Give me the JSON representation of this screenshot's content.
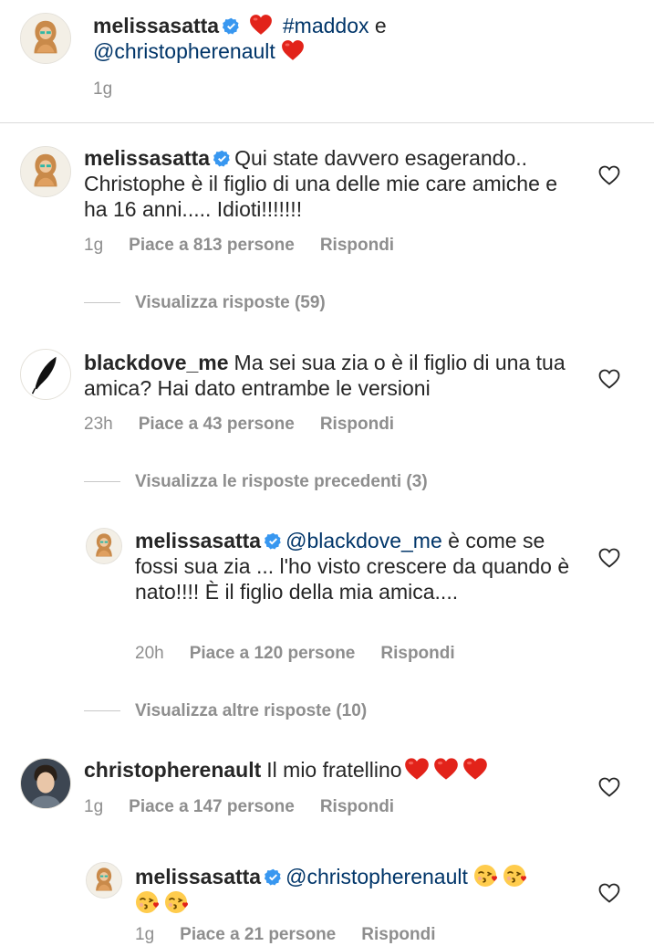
{
  "caption": {
    "username": "melissasatta",
    "hashtag": "#maddox",
    "conj": "e",
    "mention": "@christopherenault",
    "time": "1g"
  },
  "comments": [
    {
      "username": "melissasatta",
      "text": "Qui state davvero esagerando.. Christophe è il figlio di una delle mie care amiche e ha 16 anni..... Idioti!!!!!!!",
      "time": "1g",
      "likes": "Piace a 813 persone",
      "reply": "Rispondi",
      "view_replies": "Visualizza risposte (59)"
    },
    {
      "username": "blackdove_me",
      "text": "Ma sei sua zia o è il figlio di una tua amica? Hai dato entrambe le versioni",
      "time": "23h",
      "likes": "Piace a 43 persone",
      "reply": "Rispondi",
      "view_replies": "Visualizza le risposte precedenti (3)"
    },
    {
      "username": "melissasatta",
      "mention": "@blackdove_me",
      "text": "è come se fossi sua zia ... l'ho visto crescere da quando è nato!!!! È il figlio della mia amica....",
      "time": "20h",
      "likes": "Piace a 120 persone",
      "reply": "Rispondi",
      "view_replies": "Visualizza altre risposte (10)"
    },
    {
      "username": "christopherenault",
      "text": "Il mio fratellino",
      "time": "1g",
      "likes": "Piace a 147 persone",
      "reply": "Rispondi"
    },
    {
      "username": "melissasatta",
      "mention": "@christopherenault",
      "time": "1g",
      "likes": "Piace a 21 persone",
      "reply": "Rispondi"
    }
  ],
  "icons": {
    "verified": "verified-badge-icon",
    "heart_emoji": "red-heart-emoji",
    "kiss_emoji": "face-blowing-kiss-emoji",
    "like": "heart-outline-icon"
  },
  "colors": {
    "verified_blue": "#3897f0",
    "mention_blue": "#003569",
    "meta_gray": "#8e8e8e",
    "heart_red": "#e2231a"
  }
}
